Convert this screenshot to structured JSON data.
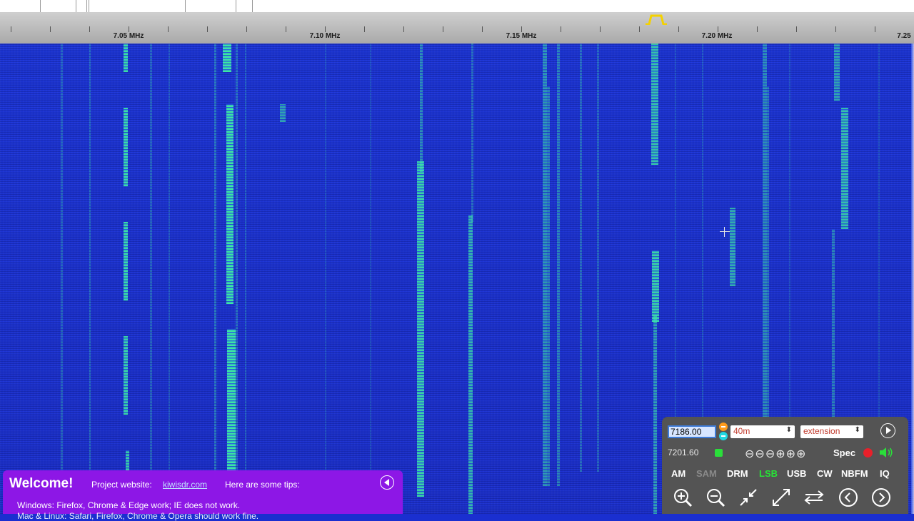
{
  "scale": {
    "labels": [
      "7.05 MHz",
      "7.10 MHz",
      "7.15 MHz",
      "7.20 MHz",
      "7.25"
    ]
  },
  "welcome": {
    "title": "Welcome!",
    "site_label": "Project website:",
    "site_link": "kiwisdr.com",
    "tips": "Here are some tips:",
    "line1": "Windows: Firefox, Chrome & Edge work; IE does not work.",
    "line2": "Mac & Linux: Safari, Firefox, Chrome & Opera should work fine."
  },
  "controls": {
    "frequency": "7186.00",
    "band": "40m",
    "extension": "extension",
    "lo_frequency": "7201.60",
    "zoom_symbols": "⊖⊖⊖⊕⊕⊕",
    "spec_label": "Spec",
    "modes": [
      "AM",
      "SAM",
      "DRM",
      "LSB",
      "USB",
      "CW",
      "NBFM",
      "IQ"
    ],
    "active_mode": "LSB",
    "accent": "#27e436"
  },
  "colors": {
    "waterfall_bg": "#1c30cc",
    "signal": "#3ef0a0",
    "welcome_bg": "#8d17e6",
    "panel_bg": "#545454"
  }
}
